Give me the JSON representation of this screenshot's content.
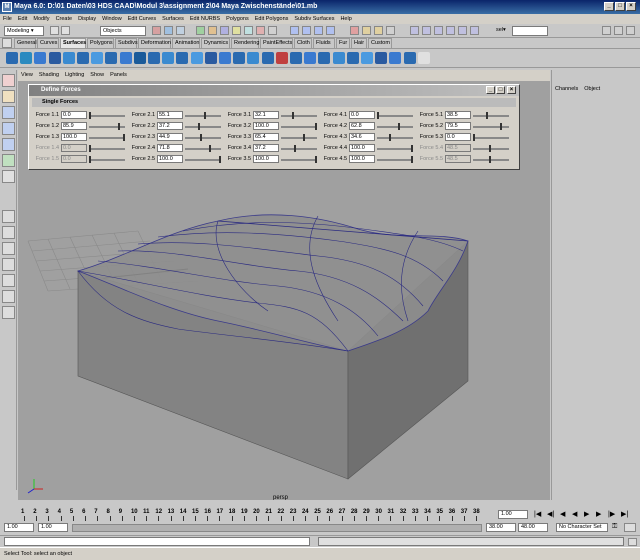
{
  "window": {
    "title": "Maya 6.0: D:\\01 Daten\\03 HDS CAAD\\Modul 3\\assignment 2\\04 Maya Zwischenstände\\01.mb"
  },
  "menubar": [
    "File",
    "Edit",
    "Modify",
    "Create",
    "Display",
    "Window",
    "Edit Curves",
    "Surfaces",
    "Edit NURBS",
    "Polygons",
    "Edit Polygons",
    "Subdiv Surfaces",
    "Help"
  ],
  "statusline": {
    "mode": "Modeling",
    "selection_mode": "Objects",
    "sel_label": "sel▾"
  },
  "shelf_tabs": [
    "General",
    "Curves",
    "Surfaces",
    "Polygons",
    "Subdivs",
    "Deformation",
    "Animation",
    "Dynamics",
    "Rendering",
    "PaintEffects",
    "Cloth",
    "Fluids",
    "Fur",
    "Hair",
    "Custom"
  ],
  "shelf_active": "Surfaces",
  "panel_menu": [
    "View",
    "Shading",
    "Lighting",
    "Show",
    "Panels"
  ],
  "viewport": {
    "camera": "persp"
  },
  "channelbox": {
    "tabs": [
      "Channels",
      "Object"
    ]
  },
  "dialog": {
    "title": "Define Forces",
    "section": "Single Forces",
    "columns": [
      {
        "rows": [
          {
            "label": "Force 1.1",
            "value": "0.0",
            "level": 0.0,
            "dim": false
          },
          {
            "label": "Force 1.2",
            "value": "85.9",
            "level": 0.86,
            "dim": false
          },
          {
            "label": "Force 1.3",
            "value": "100.0",
            "level": 1.0,
            "dim": false
          },
          {
            "label": "Force 1.4",
            "value": "0.0",
            "level": 0.0,
            "dim": true
          },
          {
            "label": "Force 1.5",
            "value": "0.0",
            "level": 0.0,
            "dim": true
          }
        ]
      },
      {
        "rows": [
          {
            "label": "Force 2.1",
            "value": "55.1",
            "level": 0.55,
            "dim": false
          },
          {
            "label": "Force 2.2",
            "value": "37.2",
            "level": 0.37,
            "dim": false
          },
          {
            "label": "Force 2.3",
            "value": "44.9",
            "level": 0.45,
            "dim": false
          },
          {
            "label": "Force 2.4",
            "value": "71.8",
            "level": 0.72,
            "dim": false
          },
          {
            "label": "Force 2.5",
            "value": "100.0",
            "level": 1.0,
            "dim": false
          }
        ]
      },
      {
        "rows": [
          {
            "label": "Force 3.1",
            "value": "32.1",
            "level": 0.32,
            "dim": false
          },
          {
            "label": "Force 3.2",
            "value": "100.0",
            "level": 1.0,
            "dim": false
          },
          {
            "label": "Force 3.3",
            "value": "65.4",
            "level": 0.65,
            "dim": false
          },
          {
            "label": "Force 3.4",
            "value": "37.2",
            "level": 0.37,
            "dim": false
          },
          {
            "label": "Force 3.5",
            "value": "100.0",
            "level": 1.0,
            "dim": false
          }
        ]
      },
      {
        "rows": [
          {
            "label": "Force 4.1",
            "value": "0.0",
            "level": 0.0,
            "dim": false
          },
          {
            "label": "Force 4.2",
            "value": "62.8",
            "level": 0.63,
            "dim": false
          },
          {
            "label": "Force 4.3",
            "value": "34.6",
            "level": 0.35,
            "dim": false
          },
          {
            "label": "Force 4.4",
            "value": "100.0",
            "level": 1.0,
            "dim": false
          },
          {
            "label": "Force 4.5",
            "value": "100.0",
            "level": 1.0,
            "dim": false
          }
        ]
      },
      {
        "rows": [
          {
            "label": "Force 5.1",
            "value": "38.5",
            "level": 0.385,
            "dim": false
          },
          {
            "label": "Force 5.2",
            "value": "79.5",
            "level": 0.795,
            "dim": false
          },
          {
            "label": "Force 5.3",
            "value": "0.0",
            "level": 0.0,
            "dim": false
          },
          {
            "label": "Force 5.4",
            "value": "48.5",
            "level": 0.485,
            "dim": true
          },
          {
            "label": "Force 5.5",
            "value": "48.5",
            "level": 0.485,
            "dim": true
          }
        ]
      }
    ]
  },
  "timeslider": {
    "ticks": [
      "1",
      "2",
      "3",
      "4",
      "5",
      "6",
      "7",
      "8",
      "9",
      "10",
      "11",
      "12",
      "13",
      "14",
      "15",
      "16",
      "17",
      "18",
      "19",
      "20",
      "21",
      "22",
      "23",
      "24",
      "25",
      "26",
      "27",
      "28",
      "29",
      "30",
      "31",
      "32",
      "33",
      "34",
      "35",
      "36",
      "37",
      "38"
    ],
    "current_frame": "1.00"
  },
  "range": {
    "start": "1.00",
    "playback_start": "1.00",
    "playback_end": "38.00",
    "end": "48.00",
    "character_set": "No Character Set"
  },
  "helpline": {
    "text": "Select Tool: select an object"
  }
}
